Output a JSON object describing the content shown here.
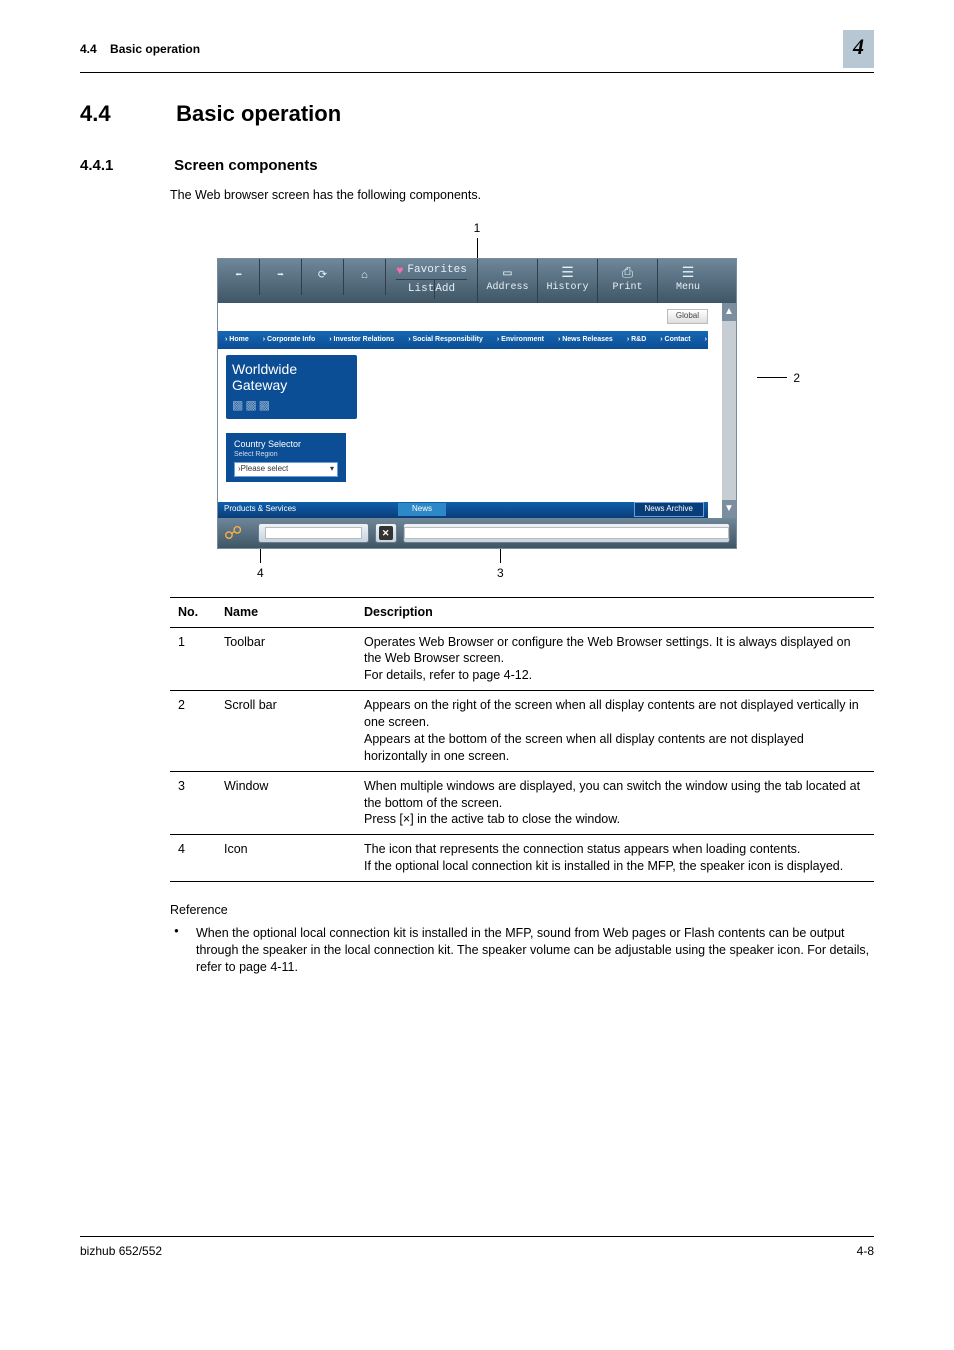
{
  "running_header": {
    "section_no": "4.4",
    "section_title": "Basic operation"
  },
  "chapter_badge": "4",
  "h1": {
    "no": "4.4",
    "title": "Basic operation"
  },
  "h2": {
    "no": "4.4.1",
    "title": "Screen components"
  },
  "intro": "The Web browser screen has the following components.",
  "callouts": {
    "top": "1",
    "right": "2",
    "bottom_left": "4",
    "bottom_center": "3"
  },
  "toolbar": {
    "favorites": "Favorites",
    "list": "List",
    "add": "Add",
    "address": "Address",
    "history": "History",
    "print": "Print",
    "menu": "Menu"
  },
  "page_preview": {
    "global": "Global",
    "nav": [
      "› Home",
      "› Corporate Info",
      "› Investor Relations",
      "› Social Responsibility",
      "› Environment",
      "› News Releases",
      "› R&D",
      "› Contact",
      "› MotoGP"
    ],
    "worldwide": "Worldwide",
    "gateway": "Gateway",
    "country_selector": "Country Selector",
    "select_region": "Select Region",
    "please_select": "›Please select",
    "products_services": "Products & Services",
    "news": "News",
    "news_archive": "News Archive"
  },
  "table": {
    "headers": {
      "no": "No.",
      "name": "Name",
      "desc": "Description"
    },
    "rows": [
      {
        "no": "1",
        "name": "Toolbar",
        "desc": "Operates Web Browser or configure the Web Browser settings. It is always displayed on the Web Browser screen.\nFor details, refer to page 4-12."
      },
      {
        "no": "2",
        "name": "Scroll bar",
        "desc": "Appears on the right of the screen when all display contents are not displayed vertically in one screen.\nAppears at the bottom of the screen when all display contents are not displayed horizontally in one screen."
      },
      {
        "no": "3",
        "name": "Window",
        "desc": "When multiple windows are displayed, you can switch the window using the tab located at the bottom of the screen.\nPress [×] in the active tab to close the window."
      },
      {
        "no": "4",
        "name": "Icon",
        "desc": "The icon that represents the connection status appears when loading contents.\nIf the optional local connection kit is installed in the MFP, the speaker icon is displayed."
      }
    ]
  },
  "reference_label": "Reference",
  "reference_bullet": "When the optional local connection kit is installed in the MFP, sound from Web pages or Flash contents can be output through the speaker in the local connection kit. The speaker volume can be adjustable using the speaker icon. For details, refer to page 4-11.",
  "footer": {
    "left": "bizhub 652/552",
    "right": "4-8"
  }
}
